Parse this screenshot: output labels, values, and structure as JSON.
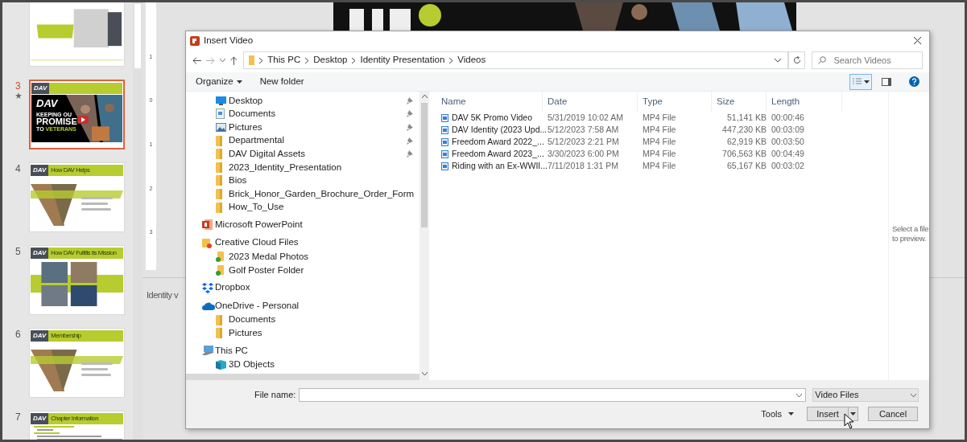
{
  "slides_panel": {
    "slides": [
      {
        "selected": false,
        "kind": "title-card",
        "animated": false
      },
      {
        "number": "3",
        "selected": true,
        "kind": "video",
        "logo": "DAV",
        "headline": [
          "DAV",
          "KEEPING OU",
          "PROMISE",
          "TO",
          "VETERANS"
        ],
        "animated": true
      },
      {
        "number": "4",
        "selected": false,
        "kind": "photo-v",
        "logo": "DAV",
        "title": "How DAV Helps",
        "animated": false
      },
      {
        "number": "5",
        "selected": false,
        "kind": "photo-grid",
        "logo": "DAV",
        "title": "How DAV Fulfills its Mission",
        "animated": false
      },
      {
        "number": "6",
        "selected": false,
        "kind": "photo-v",
        "logo": "DAV",
        "title": "Membership",
        "animated": false
      },
      {
        "number": "7",
        "selected": false,
        "kind": "list",
        "logo": "DAV",
        "title": "Chapter Information",
        "animated": false
      }
    ]
  },
  "ruler": {
    "labels": [
      "1",
      "0",
      "1",
      "2",
      "3"
    ]
  },
  "notes": {
    "text": "Identity v"
  },
  "dialog": {
    "title": "Insert Video",
    "path": [
      "This PC",
      "Desktop",
      "Identity Presentation",
      "Videos"
    ],
    "search": {
      "placeholder": "Search Videos"
    },
    "toolbar": {
      "organize": "Organize",
      "new_folder": "New folder"
    },
    "nav_tree": [
      {
        "label": "Desktop",
        "kind": "desktop",
        "pinned": true
      },
      {
        "label": "Documents",
        "kind": "documents",
        "pinned": true
      },
      {
        "label": "Pictures",
        "kind": "pictures",
        "pinned": true
      },
      {
        "label": "Departmental",
        "kind": "folder",
        "pinned": true
      },
      {
        "label": "DAV Digital Assets",
        "kind": "folder",
        "pinned": true
      },
      {
        "label": "2023_Identity_Presentation",
        "kind": "folder",
        "pinned": false
      },
      {
        "label": "Bios",
        "kind": "folder",
        "pinned": false
      },
      {
        "label": "Brick_Honor_Garden_Brochure_Order_Form",
        "kind": "folder",
        "pinned": false
      },
      {
        "label": "How_To_Use",
        "kind": "folder",
        "pinned": false
      },
      {
        "label": "Microsoft PowerPoint",
        "kind": "powerpoint"
      },
      {
        "label": "Creative Cloud Files",
        "kind": "cloud-folder",
        "children": [
          {
            "label": "2023 Medal Photos",
            "kind": "synced-folder"
          },
          {
            "label": "Golf Poster Folder",
            "kind": "synced-folder"
          }
        ]
      },
      {
        "label": "Dropbox",
        "kind": "dropbox"
      },
      {
        "label": "OneDrive - Personal",
        "kind": "onedrive",
        "children": [
          {
            "label": "Documents",
            "kind": "folder"
          },
          {
            "label": "Pictures",
            "kind": "folder"
          }
        ]
      },
      {
        "label": "This PC",
        "kind": "pc",
        "children": [
          {
            "label": "3D Objects",
            "kind": "cube"
          }
        ]
      }
    ],
    "columns": [
      "Name",
      "Date",
      "Type",
      "Size",
      "Length"
    ],
    "files": [
      {
        "name": "DAV 5K Promo Video",
        "date": "5/31/2019 10:02 AM",
        "type": "MP4 File",
        "size": "51,141 KB",
        "length": "00:00:46"
      },
      {
        "name": "DAV Identity (2023 Upd...",
        "date": "5/12/2023 7:58 AM",
        "type": "MP4 File",
        "size": "447,230 KB",
        "length": "00:03:09"
      },
      {
        "name": "Freedom Award 2022_...",
        "date": "5/12/2023 2:21 PM",
        "type": "MP4 File",
        "size": "62,919 KB",
        "length": "00:03:50"
      },
      {
        "name": "Freedom Award 2023_...",
        "date": "3/30/2023 6:00 PM",
        "type": "MP4 File",
        "size": "706,563 KB",
        "length": "00:04:49"
      },
      {
        "name": "Riding with an Ex-WWII...",
        "date": "7/11/2018 1:31 PM",
        "type": "MP4 File",
        "size": "65,167 KB",
        "length": "00:03:02"
      }
    ],
    "preview": "Select a file to preview.",
    "file_name": {
      "label": "File name:"
    },
    "filter": "Video Files",
    "tools": "Tools",
    "insert": "Insert",
    "cancel": "Cancel"
  }
}
